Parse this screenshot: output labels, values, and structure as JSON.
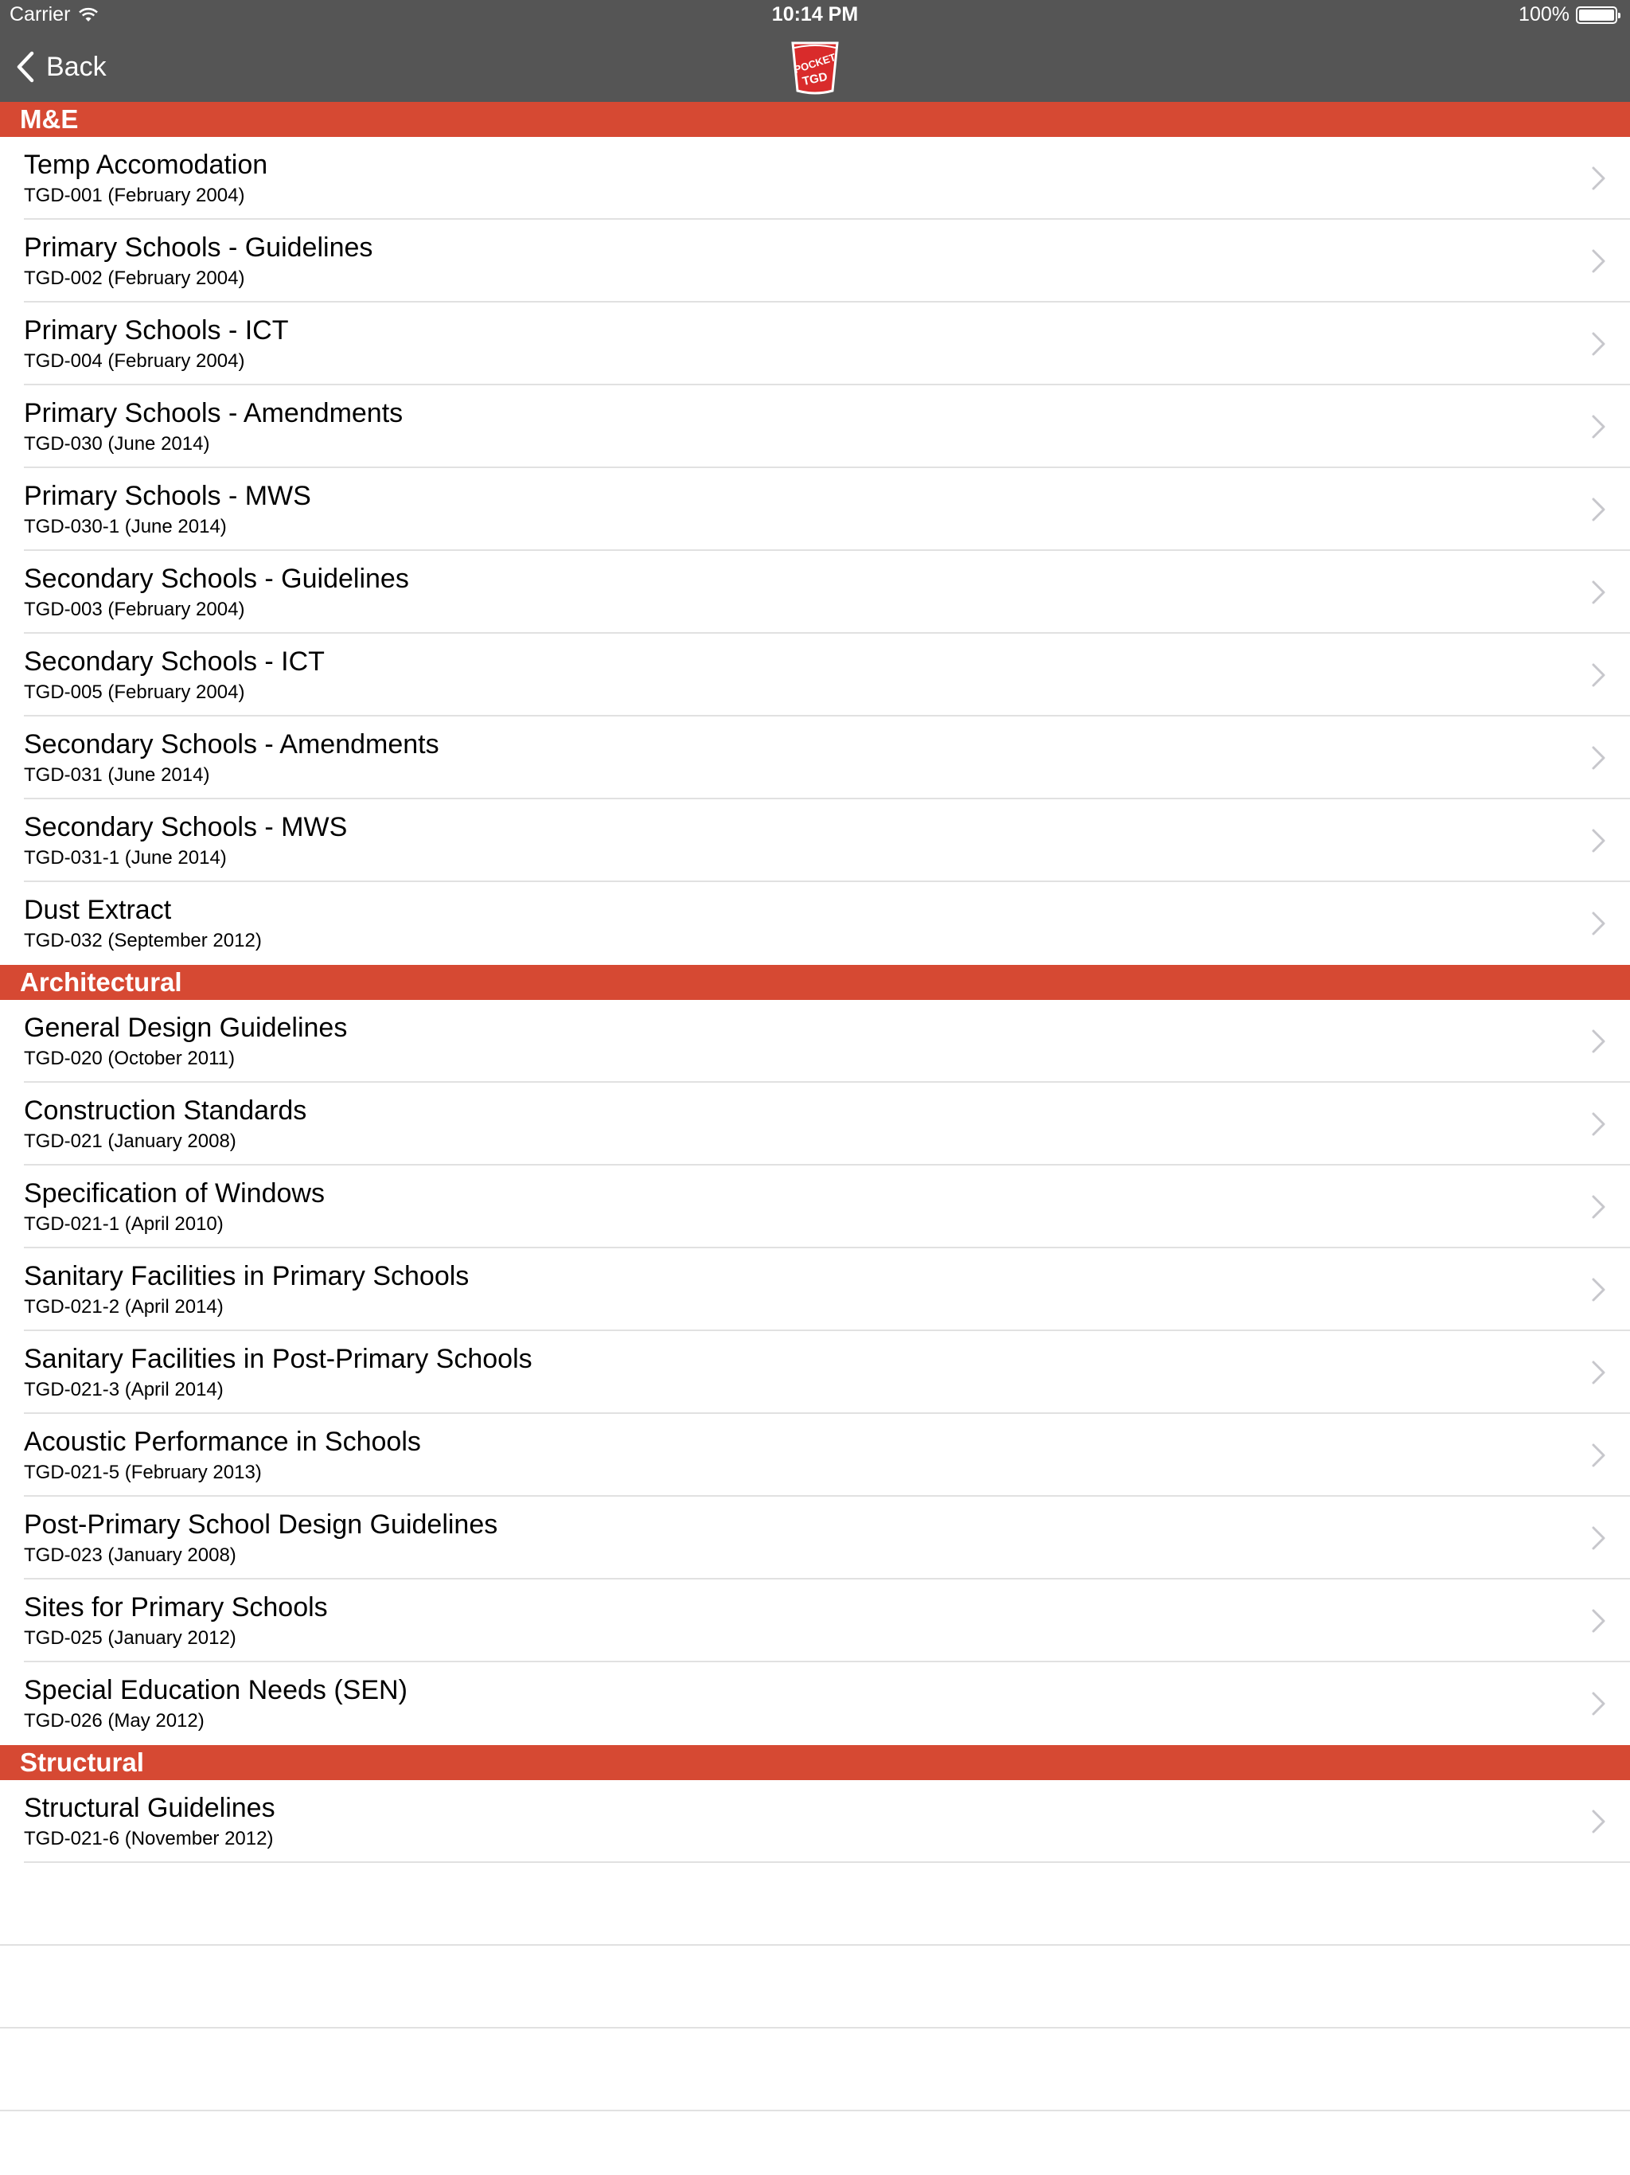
{
  "status": {
    "carrier": "Carrier",
    "time": "10:14 PM",
    "battery": "100%"
  },
  "nav": {
    "back_label": "Back",
    "logo_text_top": "POCKET",
    "logo_text_bottom": "TGD"
  },
  "colors": {
    "nav_bg": "#555555",
    "section_bg": "#d64933"
  },
  "sections": [
    {
      "title": "M&E",
      "items": [
        {
          "title": "Temp Accomodation",
          "subtitle": "TGD-001 (February 2004)"
        },
        {
          "title": "Primary Schools - Guidelines",
          "subtitle": "TGD-002 (February 2004)"
        },
        {
          "title": "Primary Schools - ICT",
          "subtitle": "TGD-004 (February 2004)"
        },
        {
          "title": "Primary Schools - Amendments",
          "subtitle": "TGD-030 (June 2014)"
        },
        {
          "title": "Primary Schools - MWS",
          "subtitle": "TGD-030-1 (June 2014)"
        },
        {
          "title": "Secondary Schools - Guidelines",
          "subtitle": "TGD-003 (February 2004)"
        },
        {
          "title": "Secondary Schools - ICT",
          "subtitle": "TGD-005 (February 2004)"
        },
        {
          "title": "Secondary Schools - Amendments",
          "subtitle": "TGD-031 (June 2014)"
        },
        {
          "title": "Secondary Schools - MWS",
          "subtitle": "TGD-031-1 (June 2014)"
        },
        {
          "title": "Dust Extract",
          "subtitle": "TGD-032 (September 2012)"
        }
      ]
    },
    {
      "title": "Architectural",
      "items": [
        {
          "title": "General Design Guidelines",
          "subtitle": "TGD-020 (October 2011)"
        },
        {
          "title": "Construction Standards",
          "subtitle": "TGD-021 (January 2008)"
        },
        {
          "title": "Specification of Windows",
          "subtitle": "TGD-021-1 (April 2010)"
        },
        {
          "title": "Sanitary Facilities in Primary Schools",
          "subtitle": "TGD-021-2 (April 2014)"
        },
        {
          "title": "Sanitary Facilities in Post-Primary Schools",
          "subtitle": "TGD-021-3 (April 2014)"
        },
        {
          "title": "Acoustic Performance in Schools",
          "subtitle": "TGD-021-5 (February 2013)"
        },
        {
          "title": "Post-Primary School Design Guidelines",
          "subtitle": "TGD-023 (January 2008)"
        },
        {
          "title": "Sites for Primary Schools",
          "subtitle": "TGD-025 (January 2012)"
        },
        {
          "title": "Special Education Needs (SEN)",
          "subtitle": "TGD-026 (May 2012)"
        }
      ]
    },
    {
      "title": "Structural",
      "items": [
        {
          "title": "Structural Guidelines",
          "subtitle": "TGD-021-6 (November 2012)"
        }
      ]
    }
  ]
}
